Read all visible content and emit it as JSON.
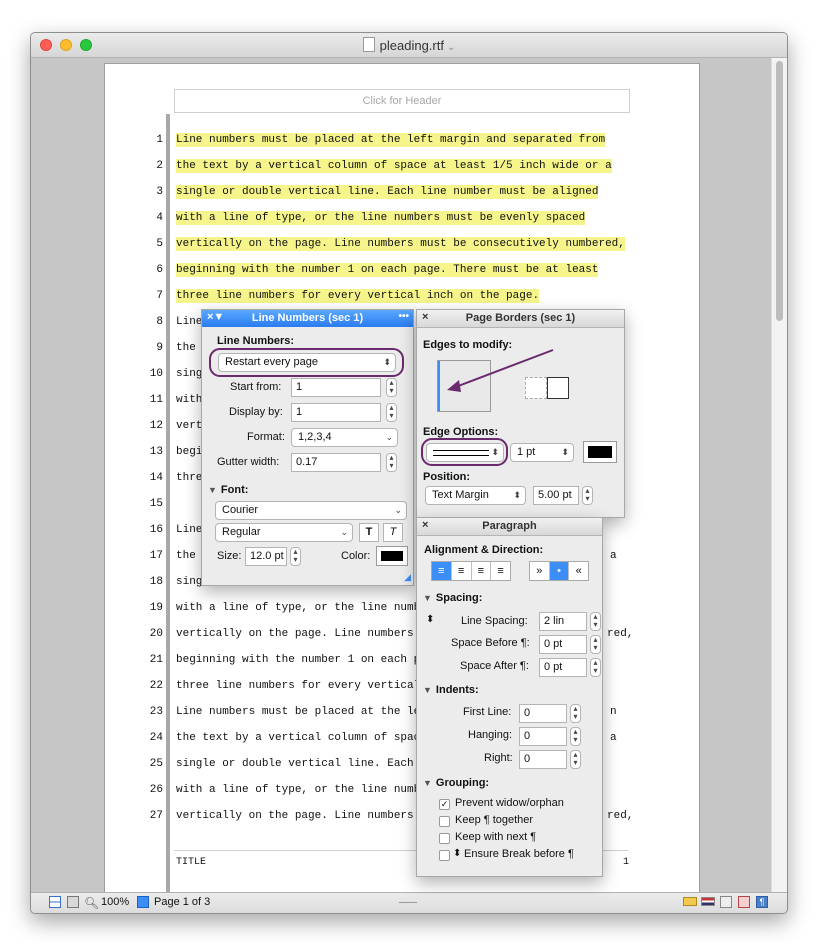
{
  "window": {
    "title": "pleading.rtf",
    "chevron": "⌄"
  },
  "document": {
    "header_placeholder": "Click for Header",
    "lines": [
      {
        "num": "1",
        "text": "Line numbers must be placed at the left margin and separated from",
        "hl": true
      },
      {
        "num": "2",
        "text": "the text by a vertical column of space at least 1/5 inch wide or a",
        "hl": true
      },
      {
        "num": "3",
        "text": "single or double vertical line. Each line number must be aligned",
        "hl": true
      },
      {
        "num": "4",
        "text": "with a line of type, or the line numbers must be evenly spaced",
        "hl": true
      },
      {
        "num": "5",
        "text": "vertically on the page. Line numbers must be consecutively numbered,",
        "hl": true
      },
      {
        "num": "6",
        "text": "beginning with the number 1 on each page. There must be at least",
        "hl": true
      },
      {
        "num": "7",
        "text": "three line numbers for every vertical inch on the page.",
        "hl": true
      },
      {
        "num": "8",
        "text": "Line",
        "hl": false
      },
      {
        "num": "9",
        "text": "the",
        "hl": false
      },
      {
        "num": "10",
        "text": "sing",
        "hl": false
      },
      {
        "num": "11",
        "text": "with",
        "hl": false
      },
      {
        "num": "12",
        "text": "vert",
        "hl": false
      },
      {
        "num": "13",
        "text": "begi",
        "hl": false
      },
      {
        "num": "14",
        "text": "thre",
        "hl": false
      },
      {
        "num": "15",
        "text": "",
        "hl": false
      },
      {
        "num": "16",
        "text": "Line",
        "hl": false
      },
      {
        "num": "17",
        "text": "the",
        "hl": false
      },
      {
        "num": "18",
        "text": "sing",
        "hl": false
      },
      {
        "num": "19",
        "text": "with a line of type, or the line numb",
        "hl": false
      },
      {
        "num": "20",
        "text": "vertically on the page. Line numbers",
        "hl": false
      },
      {
        "num": "21",
        "text": "beginning with the number 1 on each p",
        "hl": false
      },
      {
        "num": "22",
        "text": "three line numbers for every vertical",
        "hl": false
      },
      {
        "num": "23",
        "text": "Line numbers must be placed at the le",
        "hl": false
      },
      {
        "num": "24",
        "text": "the text by a vertical column of spac",
        "hl": false
      },
      {
        "num": "25",
        "text": "single or double vertical line. Each",
        "hl": false
      },
      {
        "num": "26",
        "text": "with a line of type, or the line numb",
        "hl": false
      },
      {
        "num": "27",
        "text": "vertically on the page. Line numbers",
        "hl": false
      }
    ],
    "right_frags": [
      {
        "row": 8,
        "text": "e"
      },
      {
        "row": 17,
        "text": "a"
      },
      {
        "row": 20,
        "text": "red,"
      },
      {
        "row": 23,
        "text": "n"
      },
      {
        "row": 24,
        "text": "a"
      },
      {
        "row": 27,
        "text": "red,"
      }
    ],
    "footer_title": "TITLE",
    "footer_page": "1"
  },
  "status": {
    "zoom": "100%",
    "page": "Page 1 of 3"
  },
  "line_numbers_panel": {
    "title": "Line Numbers (sec 1)",
    "close": "×▼",
    "more": "•••",
    "section_label": "Line Numbers:",
    "mode": "Restart every page",
    "start_from_label": "Start from:",
    "start_from": "1",
    "display_by_label": "Display by:",
    "display_by": "1",
    "format_label": "Format:",
    "format": "1,2,3,4",
    "gutter_label": "Gutter width:",
    "gutter": "0.17",
    "font_label": "Font:",
    "font_family": "Courier",
    "font_style": "Regular",
    "bold_btn": "T",
    "italic_btn": "T",
    "size_label": "Size:",
    "size": "12.0 pt",
    "color_label": "Color:",
    "color": "#000000"
  },
  "page_borders_panel": {
    "title": "Page Borders (sec 1)",
    "close": "×",
    "edges_label": "Edges to modify:",
    "edge_options_label": "Edge Options:",
    "width": "1 pt",
    "position_label": "Position:",
    "position": "Text Margin",
    "position_value": "5.00 pt",
    "color": "#000000"
  },
  "paragraph_panel": {
    "title": "Paragraph",
    "close": "×",
    "align_label": "Alignment & Direction:",
    "spacing_label": "Spacing:",
    "line_spacing_label": "Line Spacing:",
    "line_spacing": "2 lin",
    "space_before_label": "Space Before ¶:",
    "space_before": "0 pt",
    "space_after_label": "Space After ¶:",
    "space_after": "0 pt",
    "indents_label": "Indents:",
    "first_line_label": "First Line:",
    "first_line": "0",
    "hanging_label": "Hanging:",
    "hanging": "0",
    "right_label": "Right:",
    "right": "0",
    "grouping_label": "Grouping:",
    "grouping": [
      {
        "label": "Prevent widow/orphan",
        "checked": true
      },
      {
        "label": "Keep ¶ together",
        "checked": false
      },
      {
        "label": "Keep with next ¶",
        "checked": false
      },
      {
        "label": "Ensure Break before ¶",
        "checked": false
      }
    ]
  },
  "annotation_color": "#6b2a6e"
}
